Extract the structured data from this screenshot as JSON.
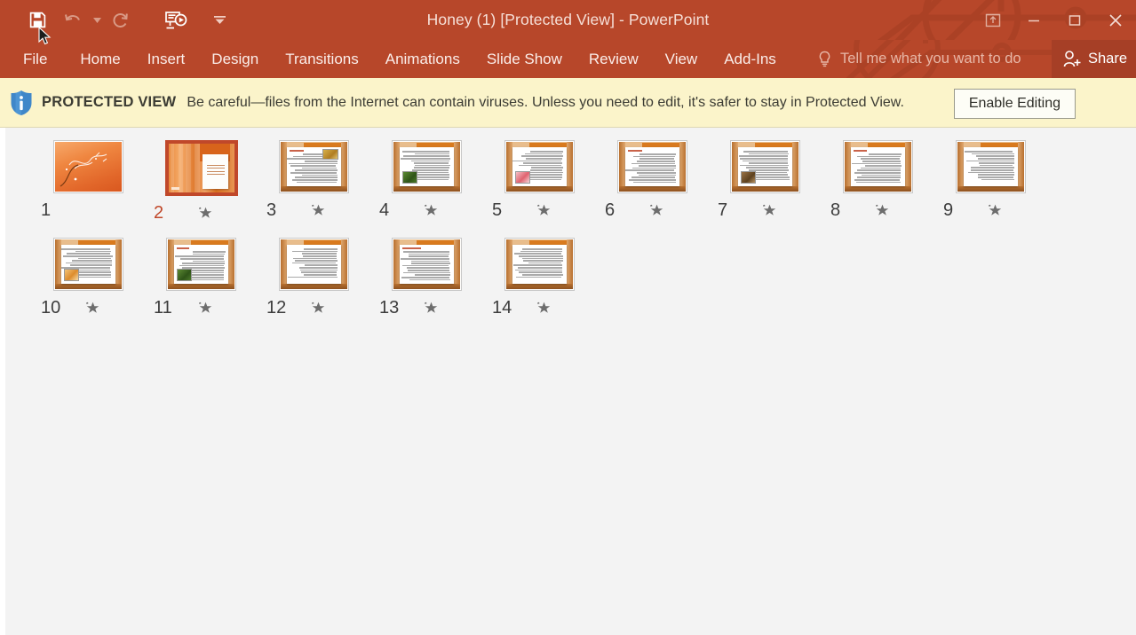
{
  "window": {
    "title": "Honey (1) [Protected View] - PowerPoint",
    "accent_color": "#b7472a",
    "controls": {
      "ribbon_display_options": "ribbon-display-options",
      "minimize": "minimize",
      "restore": "restore-down",
      "close": "close"
    }
  },
  "quick_access": {
    "items": [
      {
        "name": "save",
        "icon": "save-icon",
        "state": "enabled"
      },
      {
        "name": "undo",
        "icon": "undo-icon",
        "state": "disabled"
      },
      {
        "name": "undo-dropdown",
        "icon": "chevron-down-icon",
        "state": "disabled"
      },
      {
        "name": "redo",
        "icon": "redo-icon",
        "state": "disabled"
      },
      {
        "name": "start-from-beginning",
        "icon": "slideshow-icon",
        "state": "enabled"
      },
      {
        "name": "customize-quick-access-toolbar",
        "icon": "chevron-down-icon",
        "state": "enabled"
      }
    ]
  },
  "ribbon": {
    "tabs": [
      {
        "label": "File",
        "id": "file"
      },
      {
        "label": "Home",
        "id": "home"
      },
      {
        "label": "Insert",
        "id": "insert"
      },
      {
        "label": "Design",
        "id": "design"
      },
      {
        "label": "Transitions",
        "id": "transitions"
      },
      {
        "label": "Animations",
        "id": "animations"
      },
      {
        "label": "Slide Show",
        "id": "slide-show"
      },
      {
        "label": "Review",
        "id": "review"
      },
      {
        "label": "View",
        "id": "view"
      },
      {
        "label": "Add-Ins",
        "id": "add-ins"
      }
    ],
    "tell_me": {
      "placeholder": "Tell me what you want to do",
      "icon": "lightbulb-icon"
    },
    "share": {
      "label": "Share",
      "icon": "person-add-icon"
    }
  },
  "protected_view": {
    "icon": "shield-info-icon",
    "label": "PROTECTED VIEW",
    "message": "Be careful—files from the Internet can contain viruses. Unless you need to edit, it's safer to stay in Protected View.",
    "enable_button": "Enable Editing",
    "background_color": "#fbf4ca"
  },
  "slide_sorter": {
    "selected_slide": 2,
    "slides": [
      {
        "number": "1",
        "kind": "title",
        "starred": false,
        "images": []
      },
      {
        "number": "2",
        "kind": "section",
        "starred": true,
        "images": []
      },
      {
        "number": "3",
        "kind": "content",
        "starred": true,
        "images": [
          {
            "color": "gold",
            "pos": "top-right"
          }
        ]
      },
      {
        "number": "4",
        "kind": "content",
        "starred": true,
        "images": [
          {
            "color": "green",
            "pos": "bottom-left"
          }
        ]
      },
      {
        "number": "5",
        "kind": "content",
        "starred": true,
        "images": [
          {
            "color": "pink",
            "pos": "bottom-left"
          }
        ]
      },
      {
        "number": "6",
        "kind": "content",
        "starred": true,
        "images": []
      },
      {
        "number": "7",
        "kind": "content",
        "starred": true,
        "images": [
          {
            "color": "brown",
            "pos": "bottom-left"
          }
        ]
      },
      {
        "number": "8",
        "kind": "content",
        "starred": true,
        "images": []
      },
      {
        "number": "9",
        "kind": "content",
        "starred": true,
        "images": []
      },
      {
        "number": "10",
        "kind": "content",
        "starred": true,
        "images": [
          {
            "color": "amber",
            "pos": "bottom-left"
          }
        ]
      },
      {
        "number": "11",
        "kind": "content",
        "starred": true,
        "images": [
          {
            "color": "green",
            "pos": "bottom-left"
          }
        ]
      },
      {
        "number": "12",
        "kind": "content",
        "starred": true,
        "images": []
      },
      {
        "number": "13",
        "kind": "content",
        "starred": true,
        "images": []
      },
      {
        "number": "14",
        "kind": "content",
        "starred": true,
        "images": []
      }
    ],
    "star_icon": "star-icon",
    "background_color": "#f3f3f3"
  }
}
